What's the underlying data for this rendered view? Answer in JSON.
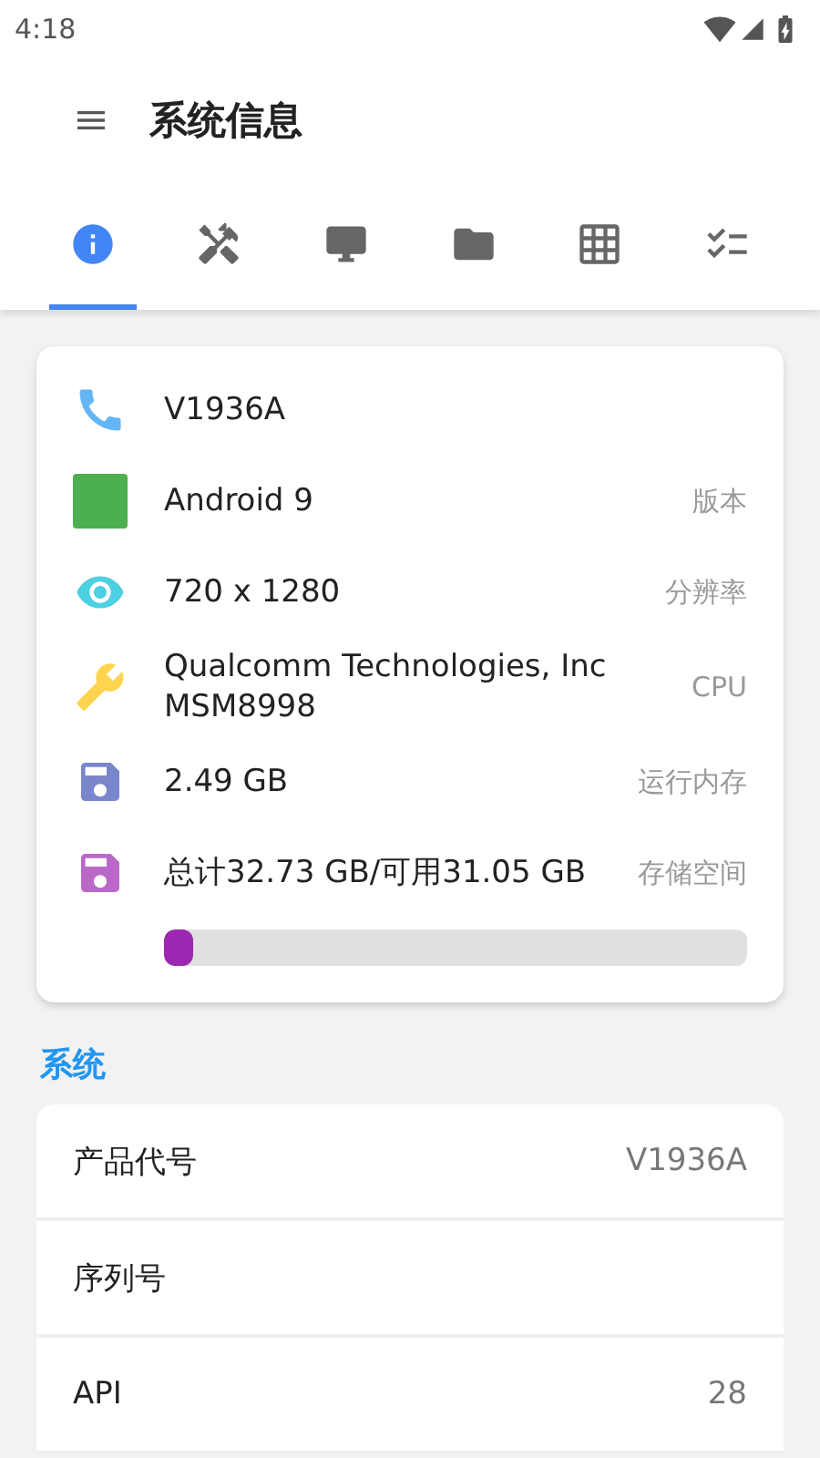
{
  "status_bar": {
    "time": "4:18"
  },
  "app_bar": {
    "title": "系统信息"
  },
  "tabs": [
    {
      "kind": "info",
      "selected": true
    },
    {
      "kind": "tools",
      "selected": false
    },
    {
      "kind": "display",
      "selected": false
    },
    {
      "kind": "folder",
      "selected": false
    },
    {
      "kind": "grid",
      "selected": false
    },
    {
      "kind": "checklist",
      "selected": false
    }
  ],
  "summary": [
    {
      "kind": "phone",
      "value": "V1936A"
    },
    {
      "kind": "android",
      "value": "Android 9",
      "label": "版本"
    },
    {
      "kind": "eye",
      "value": "720 x 1280",
      "label": "分辨率"
    },
    {
      "kind": "wrench",
      "value": "Qualcomm Technologies, Inc MSM8998",
      "label": "CPU"
    },
    {
      "kind": "ram",
      "value": "2.49 GB",
      "label": "运行内存"
    },
    {
      "kind": "storage",
      "value": "总计32.73 GB/可用31.05 GB",
      "label": "存储空间",
      "level": 0.05
    }
  ],
  "section": {
    "title": "系统",
    "rows": [
      {
        "label": "产品代号",
        "value": "V1936A"
      },
      {
        "label": "序列号"
      },
      {
        "label": "API",
        "value": "28"
      }
    ]
  }
}
